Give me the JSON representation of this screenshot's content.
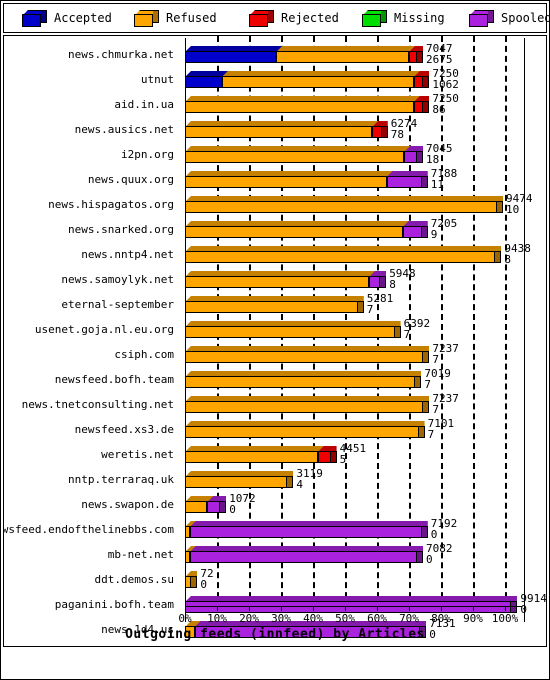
{
  "legend": {
    "items": [
      {
        "label": "Accepted",
        "color": "#0000cc",
        "name": "legend-accepted"
      },
      {
        "label": "Refused",
        "color": "#ffa500",
        "name": "legend-refused"
      },
      {
        "label": "Rejected",
        "color": "#ee0000",
        "name": "legend-rejected"
      },
      {
        "label": "Missing",
        "color": "#00dd00",
        "name": "legend-missing"
      },
      {
        "label": "Spooled",
        "color": "#aa22dd",
        "name": "legend-spooled"
      }
    ]
  },
  "axis": {
    "title": "Outgoing feeds (innfeed) by Articles",
    "ticks": [
      "0%",
      "10%",
      "20%",
      "30%",
      "40%",
      "50%",
      "60%",
      "70%",
      "80%",
      "90%",
      "100%"
    ]
  },
  "colors": {
    "accepted": "#0000cc",
    "refused": "#ffa500",
    "rejected": "#ee0000",
    "missing": "#00dd00",
    "spooled": "#aa22dd"
  },
  "chart_data": {
    "type": "bar",
    "orientation": "horizontal",
    "stacked": true,
    "title": "Outgoing feeds (innfeed) by Articles",
    "xlabel": "Outgoing feeds (innfeed) by Articles",
    "ylabel": "",
    "xlim": [
      0,
      100
    ],
    "xunit": "%",
    "grid": true,
    "legend_position": "top",
    "series_names": [
      "Accepted",
      "Refused",
      "Rejected",
      "Missing",
      "Spooled"
    ],
    "categories": [
      "news.chmurka.net",
      "utnut",
      "aid.in.ua",
      "news.ausics.net",
      "i2pn.org",
      "news.quux.org",
      "news.hispagatos.org",
      "news.snarked.org",
      "news.nntp4.net",
      "news.samoylyk.net",
      "eternal-september",
      "usenet.goja.nl.eu.org",
      "csiph.com",
      "newsfeed.bofh.team",
      "news.tnetconsulting.net",
      "newsfeed.xs3.de",
      "weretis.net",
      "nntp.terraraq.uk",
      "news.swapon.de",
      "newsfeed.endofthelinebbs.com",
      "mb-net.net",
      "ddt.demos.su",
      "paganini.bofh.team",
      "news.1d4.us"
    ],
    "rows": [
      {
        "label": "news.chmurka.net",
        "total": 7047,
        "second": 2675,
        "pct": 72.5,
        "segments": [
          {
            "type": "accepted",
            "pct": 28.5
          },
          {
            "type": "refused",
            "pct": 41.5
          },
          {
            "type": "rejected",
            "pct": 2.5
          }
        ]
      },
      {
        "label": "utnut",
        "total": 7250,
        "second": 1062,
        "pct": 74.5,
        "segments": [
          {
            "type": "accepted",
            "pct": 11.5
          },
          {
            "type": "refused",
            "pct": 60.0
          },
          {
            "type": "rejected",
            "pct": 3.0
          }
        ]
      },
      {
        "label": "aid.in.ua",
        "total": 7250,
        "second": 86,
        "pct": 74.5,
        "segments": [
          {
            "type": "refused",
            "pct": 71.5
          },
          {
            "type": "rejected",
            "pct": 3.0
          }
        ]
      },
      {
        "label": "news.ausics.net",
        "total": 6274,
        "second": 78,
        "pct": 61.5,
        "segments": [
          {
            "type": "refused",
            "pct": 58.5
          },
          {
            "type": "rejected",
            "pct": 3.0
          }
        ]
      },
      {
        "label": "i2pn.org",
        "total": 7045,
        "second": 18,
        "pct": 72.5,
        "segments": [
          {
            "type": "refused",
            "pct": 68.5
          },
          {
            "type": "spooled",
            "pct": 4.0
          }
        ]
      },
      {
        "label": "news.quux.org",
        "total": 7188,
        "second": 11,
        "pct": 74.0,
        "segments": [
          {
            "type": "refused",
            "pct": 63.0
          },
          {
            "type": "spooled",
            "pct": 11.0
          }
        ]
      },
      {
        "label": "news.hispagatos.org",
        "total": 9474,
        "second": 10,
        "pct": 97.5,
        "segments": [
          {
            "type": "refused",
            "pct": 97.5
          }
        ]
      },
      {
        "label": "news.snarked.org",
        "total": 7205,
        "second": 9,
        "pct": 74.0,
        "segments": [
          {
            "type": "refused",
            "pct": 68.0
          },
          {
            "type": "spooled",
            "pct": 6.0
          }
        ]
      },
      {
        "label": "news.nntp4.net",
        "total": 9438,
        "second": 8,
        "pct": 97.0,
        "segments": [
          {
            "type": "refused",
            "pct": 97.0
          }
        ]
      },
      {
        "label": "news.samoylyk.net",
        "total": 5948,
        "second": 8,
        "pct": 61.0,
        "segments": [
          {
            "type": "refused",
            "pct": 57.5
          },
          {
            "type": "spooled",
            "pct": 3.5
          }
        ]
      },
      {
        "label": "eternal-september",
        "total": 5281,
        "second": 7,
        "pct": 54.0,
        "segments": [
          {
            "type": "refused",
            "pct": 54.0
          }
        ]
      },
      {
        "label": "usenet.goja.nl.eu.org",
        "total": 6392,
        "second": 7,
        "pct": 65.5,
        "segments": [
          {
            "type": "refused",
            "pct": 65.5
          }
        ]
      },
      {
        "label": "csiph.com",
        "total": 7237,
        "second": 7,
        "pct": 74.5,
        "segments": [
          {
            "type": "refused",
            "pct": 74.5
          }
        ]
      },
      {
        "label": "newsfeed.bofh.team",
        "total": 7019,
        "second": 7,
        "pct": 72.0,
        "segments": [
          {
            "type": "refused",
            "pct": 72.0
          }
        ]
      },
      {
        "label": "news.tnetconsulting.net",
        "total": 7237,
        "second": 7,
        "pct": 74.5,
        "segments": [
          {
            "type": "refused",
            "pct": 74.5
          }
        ]
      },
      {
        "label": "newsfeed.xs3.de",
        "total": 7101,
        "second": 7,
        "pct": 73.0,
        "segments": [
          {
            "type": "refused",
            "pct": 73.0
          }
        ]
      },
      {
        "label": "weretis.net",
        "total": 4451,
        "second": 5,
        "pct": 45.5,
        "segments": [
          {
            "type": "refused",
            "pct": 41.5
          },
          {
            "type": "rejected",
            "pct": 4.0
          }
        ]
      },
      {
        "label": "nntp.terraraq.uk",
        "total": 3119,
        "second": 4,
        "pct": 32.0,
        "segments": [
          {
            "type": "refused",
            "pct": 32.0
          }
        ]
      },
      {
        "label": "news.swapon.de",
        "total": 1072,
        "second": 0,
        "pct": 11.0,
        "segments": [
          {
            "type": "refused",
            "pct": 7.0
          },
          {
            "type": "spooled",
            "pct": 4.0
          }
        ]
      },
      {
        "label": "newsfeed.endofthelinebbs.com",
        "total": 7192,
        "second": 0,
        "pct": 74.0,
        "segments": [
          {
            "type": "refused",
            "pct": 1.5
          },
          {
            "type": "spooled",
            "pct": 72.5
          }
        ]
      },
      {
        "label": "mb-net.net",
        "total": 7082,
        "second": 0,
        "pct": 72.5,
        "segments": [
          {
            "type": "refused",
            "pct": 1.5
          },
          {
            "type": "spooled",
            "pct": 71.0
          }
        ]
      },
      {
        "label": "ddt.demos.su",
        "total": 72,
        "second": 0,
        "pct": 2.0,
        "segments": [
          {
            "type": "refused",
            "pct": 2.0
          }
        ]
      },
      {
        "label": "paganini.bofh.team",
        "total": 9914,
        "second": 0,
        "pct": 102.0,
        "segments": [
          {
            "type": "spooled",
            "pct": 102.0
          }
        ]
      },
      {
        "label": "news.1d4.us",
        "total": 7131,
        "second": 0,
        "pct": 73.5,
        "segments": [
          {
            "type": "refused",
            "pct": 3.0
          },
          {
            "type": "spooled",
            "pct": 70.5
          }
        ]
      }
    ]
  }
}
